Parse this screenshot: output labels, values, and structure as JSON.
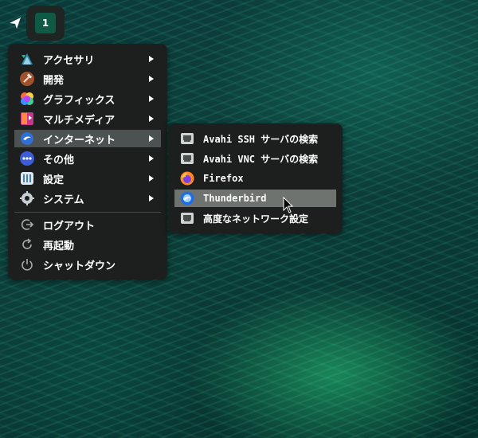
{
  "panel": {
    "workspace_number": "1"
  },
  "menu": {
    "items": [
      {
        "label": "アクセサリ",
        "icon": "accessories-icon",
        "submenu": true
      },
      {
        "label": "開発",
        "icon": "development-hammer-icon",
        "submenu": true
      },
      {
        "label": "グラフィックス",
        "icon": "graphics-icon",
        "submenu": true
      },
      {
        "label": "マルチメディア",
        "icon": "multimedia-icon",
        "submenu": true
      },
      {
        "label": "インターネット",
        "icon": "internet-icon",
        "submenu": true,
        "active": true
      },
      {
        "label": "その他",
        "icon": "other-icon",
        "submenu": true
      },
      {
        "label": "設定",
        "icon": "settings-icon",
        "submenu": true
      },
      {
        "label": "システム",
        "icon": "system-gear-icon",
        "submenu": true
      }
    ],
    "actions": [
      {
        "label": "ログアウト",
        "icon": "logout-icon"
      },
      {
        "label": "再起動",
        "icon": "restart-icon"
      },
      {
        "label": "シャットダウン",
        "icon": "shutdown-icon"
      }
    ]
  },
  "submenu": {
    "items": [
      {
        "label": "Avahi SSH サーバの検索",
        "icon": "network-icon"
      },
      {
        "label": "Avahi VNC サーバの検索",
        "icon": "network-icon"
      },
      {
        "label": "Firefox",
        "icon": "firefox-icon"
      },
      {
        "label": "Thunderbird",
        "icon": "thunderbird-icon",
        "active": true
      },
      {
        "label": "高度なネットワーク設定",
        "icon": "network-icon"
      }
    ]
  },
  "colors": {
    "menu_bg": "#1c1f1e",
    "active_bg": "#4c5251",
    "submenu_active_bg": "#6e7370",
    "workspace_active": "#0f5a44"
  }
}
